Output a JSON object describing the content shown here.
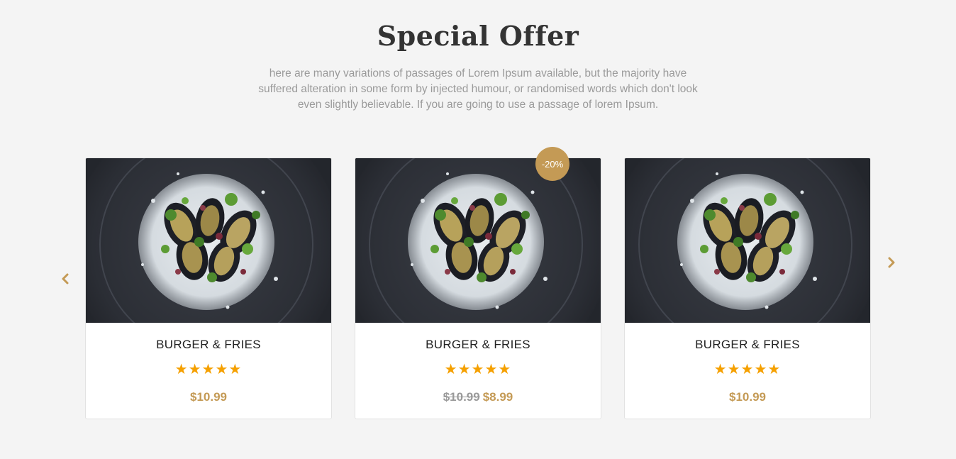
{
  "section": {
    "title": "Special Offer",
    "description": "here are many variations of passages of Lorem Ipsum available, but the majority have suffered alteration in some form by injected humour, or randomised words which don't look even slightly believable. If you are going to use a passage of lorem Ipsum."
  },
  "carousel": {
    "prev_icon": "chevron-left-icon",
    "next_icon": "chevron-right-icon",
    "accent_color": "#c49a55",
    "star_color": "#f5a000"
  },
  "products": [
    {
      "name": "BURGER & FRIES",
      "stars": "★★★★★",
      "rating": 5,
      "price": "$10.99",
      "old_price": ""
    },
    {
      "name": "BURGER & FRIES",
      "stars": "★★★★★",
      "rating": 5,
      "price": "$8.99",
      "old_price": "$10.99",
      "badge": "-20%"
    },
    {
      "name": "BURGER & FRIES",
      "stars": "★★★★★",
      "rating": 5,
      "price": "$10.99",
      "old_price": ""
    }
  ]
}
